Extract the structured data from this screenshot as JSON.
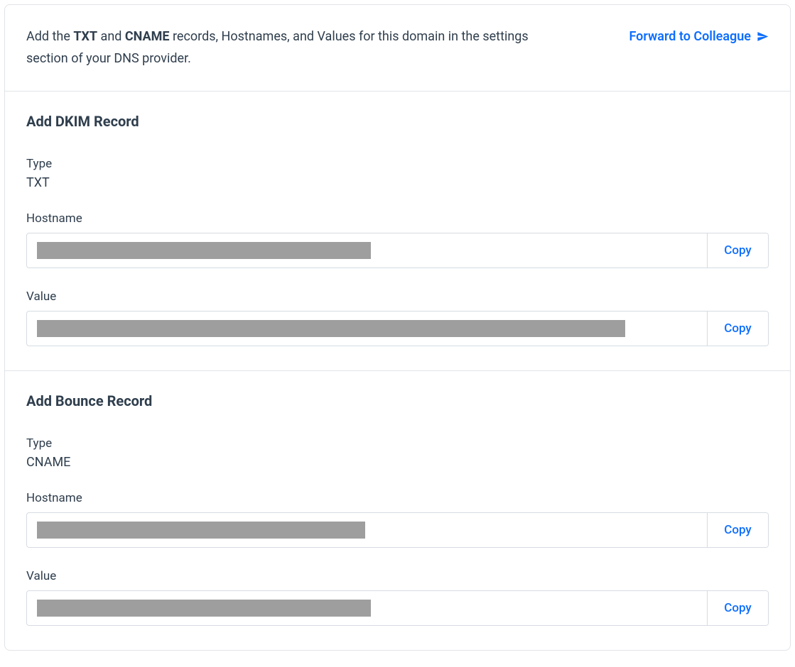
{
  "header": {
    "instruction_prefix": "Add the ",
    "txt": "TXT",
    "and": " and ",
    "cname": "CNAME",
    "instruction_suffix": " records, Hostnames, and Values for this domain in the settings section of your DNS provider.",
    "forward_label": "Forward to Colleague"
  },
  "labels": {
    "type": "Type",
    "hostname": "Hostname",
    "value": "Value",
    "copy": "Copy"
  },
  "records": {
    "dkim": {
      "title": "Add DKIM Record",
      "type": "TXT"
    },
    "bounce": {
      "title": "Add Bounce Record",
      "type": "CNAME"
    }
  }
}
